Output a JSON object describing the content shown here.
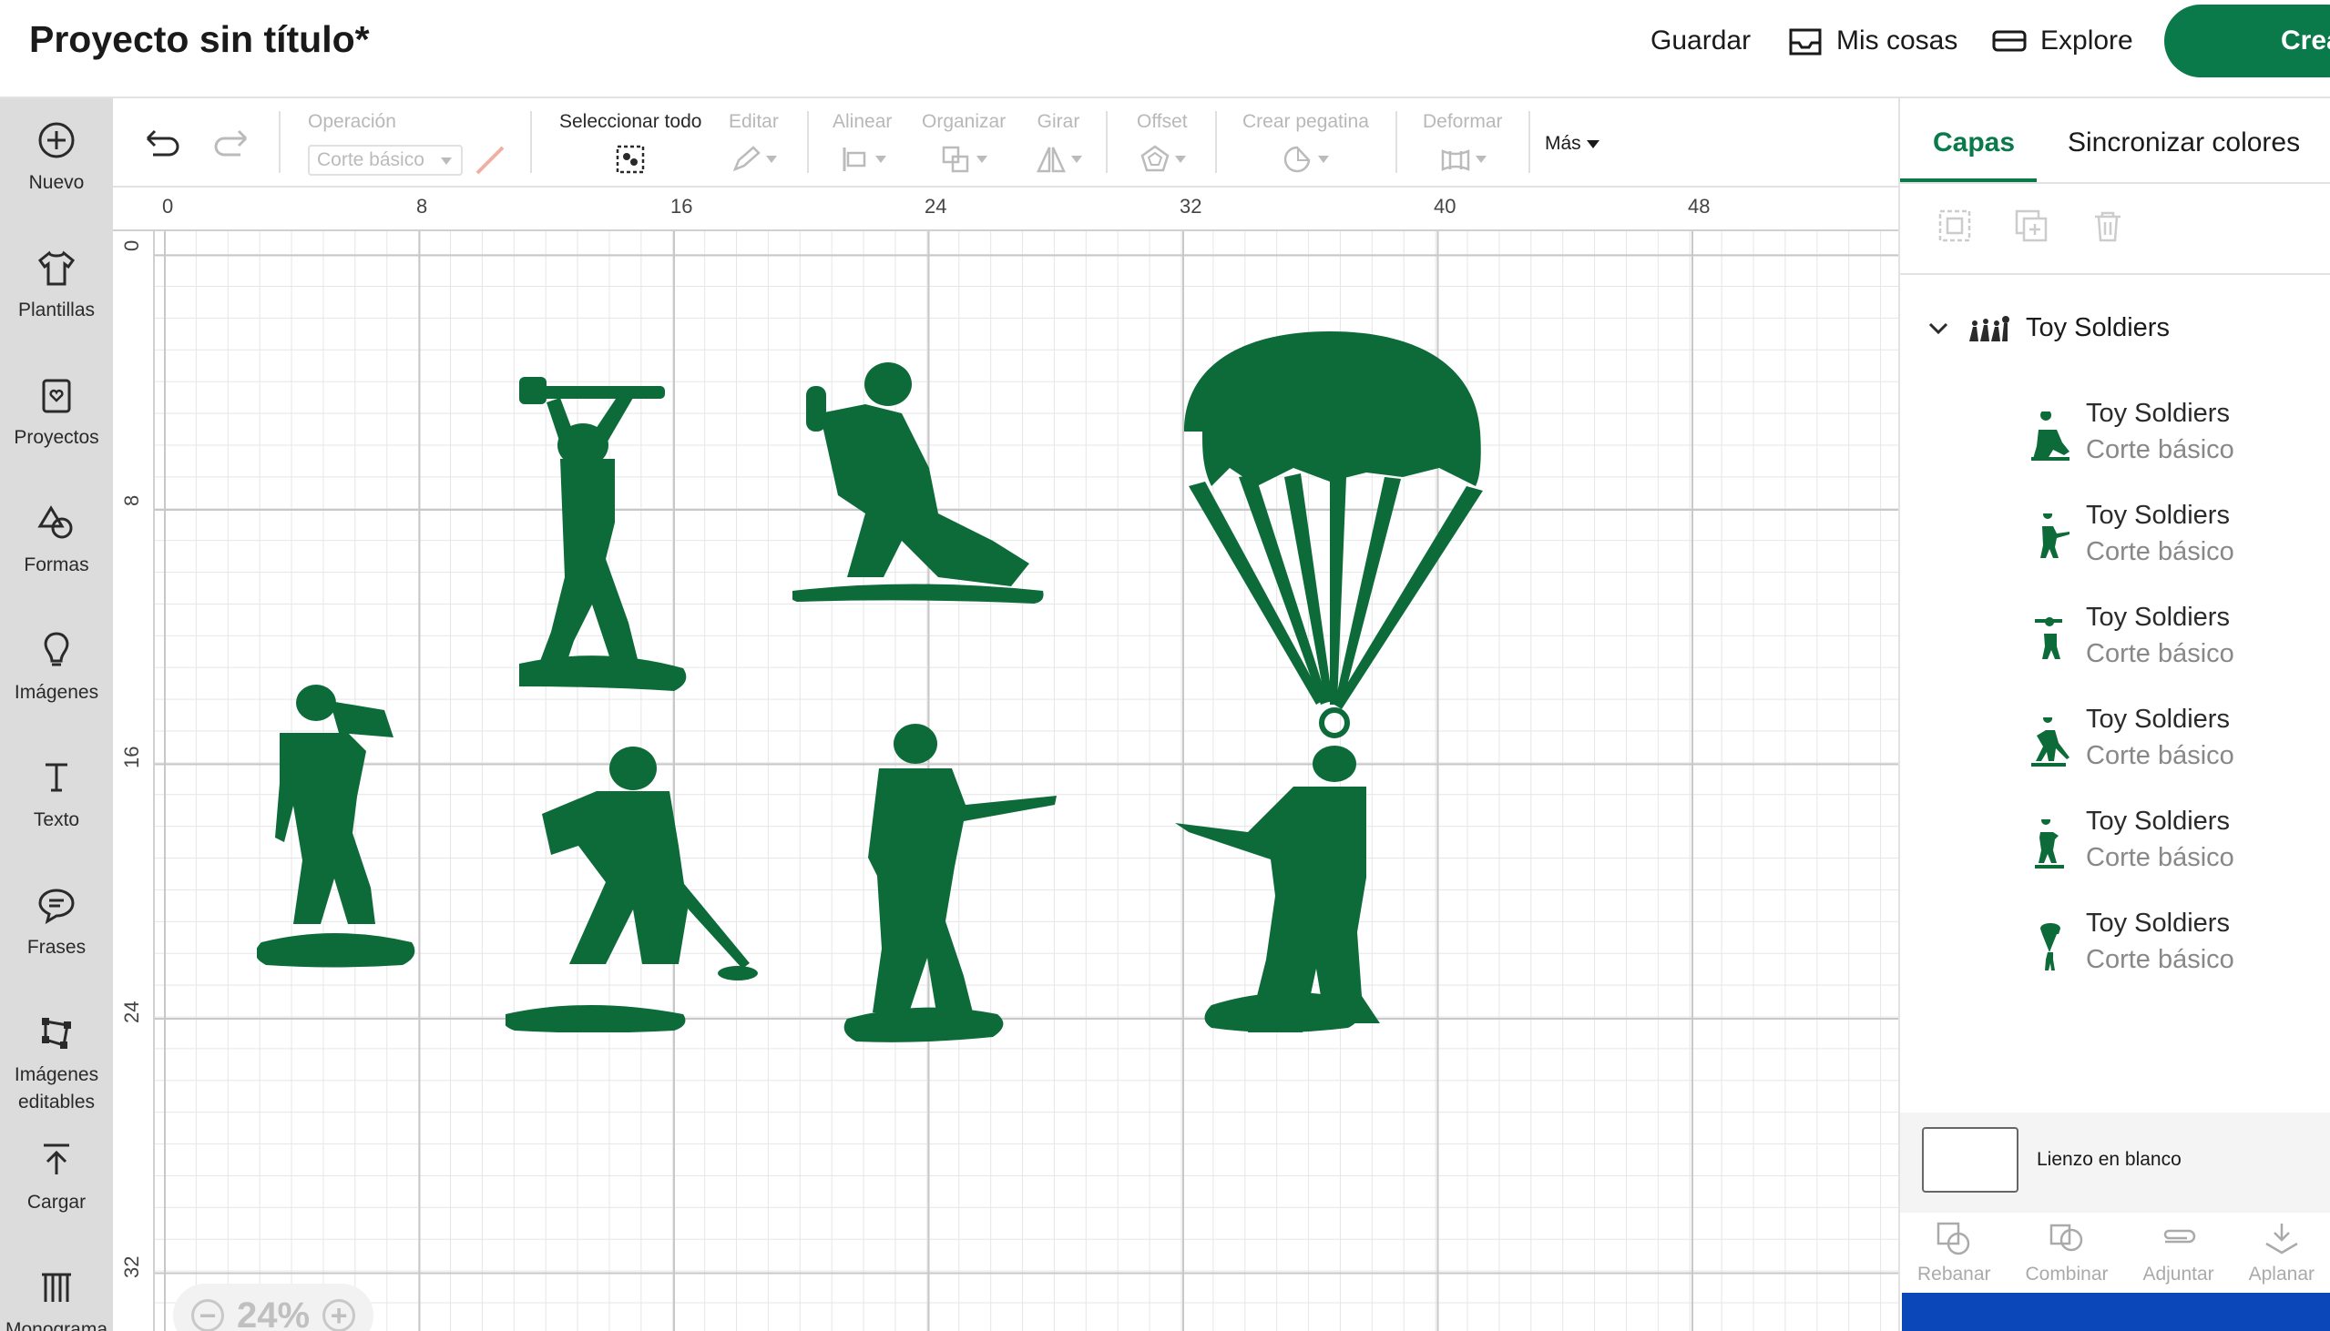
{
  "header": {
    "title": "Proyecto sin título*",
    "save": "Guardar",
    "my_stuff": "Mis cosas",
    "explore": "Explore",
    "make": "Crear"
  },
  "sidebar": {
    "items": [
      {
        "label": "Nuevo",
        "icon": "plus-circle-icon"
      },
      {
        "label": "Plantillas",
        "icon": "tshirt-icon"
      },
      {
        "label": "Proyectos",
        "icon": "clipboard-heart-icon"
      },
      {
        "label": "Formas",
        "icon": "shapes-icon"
      },
      {
        "label": "Imágenes",
        "icon": "lightbulb-icon"
      },
      {
        "label": "Texto",
        "icon": "text-icon"
      },
      {
        "label": "Frases",
        "icon": "speech-bubble-icon"
      },
      {
        "label": "Imágenes editables",
        "icon": "editable-images-icon"
      },
      {
        "label": "Cargar",
        "icon": "upload-icon"
      },
      {
        "label": "Monograma",
        "icon": "monogram-icon"
      }
    ]
  },
  "toolbar": {
    "operation_label": "Operación",
    "operation_value": "Corte básico",
    "select_all": "Seleccionar todo",
    "edit": "Editar",
    "align": "Alinear",
    "organize": "Organizar",
    "rotate": "Girar",
    "offset": "Offset",
    "sticker": "Crear pegatina",
    "warp": "Deformar",
    "more": "Más"
  },
  "ruler": {
    "top": [
      "0",
      "8",
      "16",
      "24",
      "32",
      "40",
      "48"
    ],
    "left": [
      "0",
      "8",
      "16",
      "24",
      "32"
    ]
  },
  "zoom": {
    "minus": "−",
    "value": "24%",
    "plus": "+"
  },
  "right_panel": {
    "tabs": [
      "Capas",
      "Sincronizar colores"
    ],
    "group_name": "Toy Soldiers",
    "layers": [
      {
        "name": "Toy Soldiers",
        "op": "Corte básico"
      },
      {
        "name": "Toy Soldiers",
        "op": "Corte básico"
      },
      {
        "name": "Toy Soldiers",
        "op": "Corte básico"
      },
      {
        "name": "Toy Soldiers",
        "op": "Corte básico"
      },
      {
        "name": "Toy Soldiers",
        "op": "Corte básico"
      },
      {
        "name": "Toy Soldiers",
        "op": "Corte básico"
      }
    ],
    "blank_canvas": "Lienzo en blanco",
    "actions": [
      "Rebanar",
      "Combinar",
      "Adjuntar",
      "Aplanar"
    ]
  },
  "colors": {
    "brand": "#0a7a4a",
    "shape": "#0d6b3a"
  }
}
